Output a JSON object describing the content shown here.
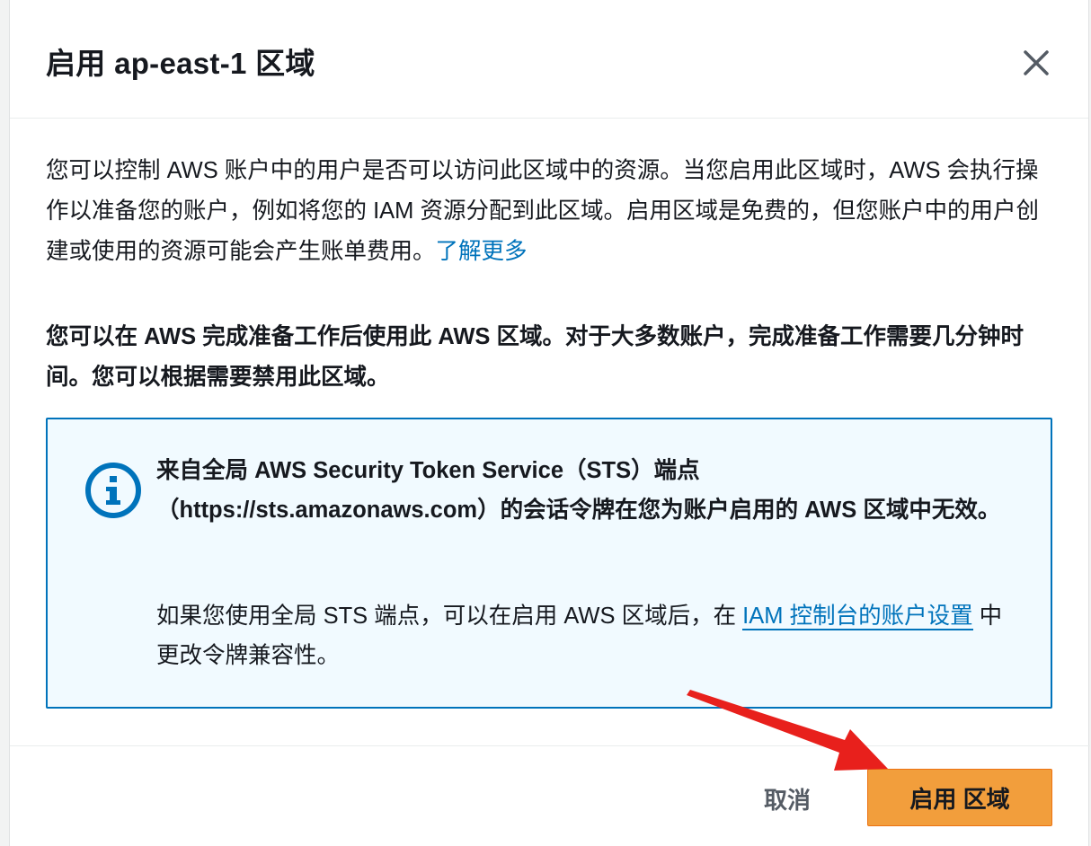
{
  "dialog": {
    "title": "启用 ap-east-1 区域",
    "close_icon": "close-icon"
  },
  "body": {
    "para1_text": "您可以控制 AWS 账户中的用户是否可以访问此区域中的资源。当您启用此区域时，AWS 会执行操作以准备您的账户，例如将您的 IAM 资源分配到此区域。启用区域是免费的，但您账户中的用户创建或使用的资源可能会产生账单费用。",
    "learn_more_link": "了解更多",
    "para2_text": "您可以在 AWS 完成准备工作后使用此 AWS 区域。对于大多数账户，完成准备工作需要几分钟时间。您可以根据需要禁用此区域。"
  },
  "info_box": {
    "icon": "info-icon",
    "bold_text": "来自全局 AWS Security Token Service（STS）端点（https://sts.amazonaws.com）的会话令牌在您为账户启用的 AWS 区域中无效。",
    "text_before_link": "如果您使用全局 STS 端点，可以在启用 AWS 区域后，在 ",
    "link_text": "IAM 控制台的账户设置",
    "text_after_link": " 中更改令牌兼容性。"
  },
  "footer": {
    "cancel_label": "取消",
    "primary_label": "启用 区域"
  },
  "colors": {
    "primary_button": "#f29e3c",
    "link": "#0073bb",
    "info_border": "#0073bb",
    "info_bg": "#f1faff",
    "arrow": "#e8201c"
  }
}
